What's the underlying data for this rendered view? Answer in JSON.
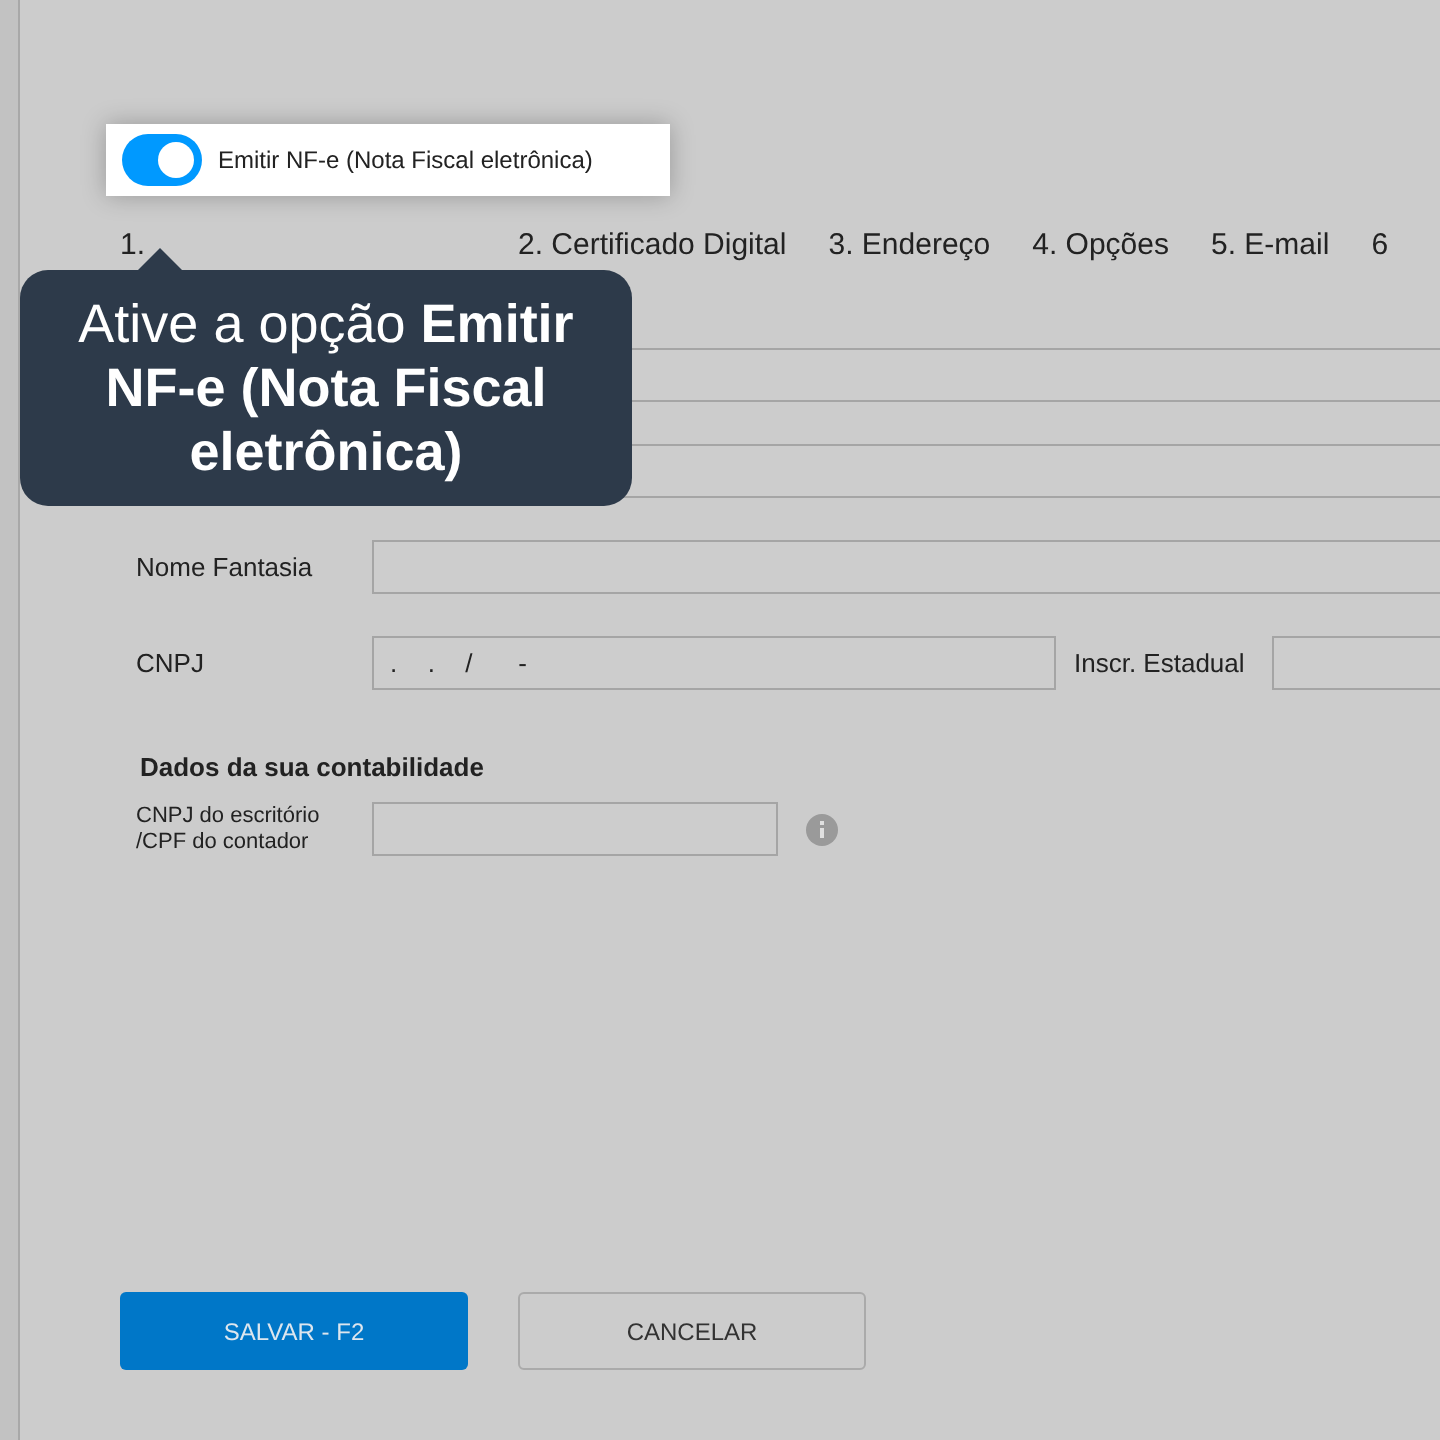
{
  "toggle": {
    "label": "Emitir NF-e (Nota Fiscal eletrônica)",
    "on": true
  },
  "tooltip": {
    "text": "Ative a opção **Emitir NF-e (Nota Fiscal eletrônica)**"
  },
  "tabs": [
    {
      "label": "1."
    },
    {
      "label": "2. Certificado Digital"
    },
    {
      "label": "3. Endereço"
    },
    {
      "label": "4. Opções"
    },
    {
      "label": "5. E-mail"
    },
    {
      "label": "6"
    }
  ],
  "fields": [
    {
      "kind": "blank"
    },
    {
      "kind": "blank"
    },
    {
      "kind": "full",
      "label": "Nome Fantasia"
    },
    {
      "kind": "pair",
      "label": "CNPJ",
      "value": ".  .  /   -",
      "label_2": "Inscr. Estadual"
    }
  ],
  "section": {
    "title": "Dados da sua contabilidade",
    "field_label": "CNPJ do escritório /CPF do contador"
  },
  "buttons": [
    {
      "label": "SALVAR - F2",
      "kind": "primary"
    },
    {
      "label": "CANCELAR",
      "kind": "secondary"
    }
  ]
}
